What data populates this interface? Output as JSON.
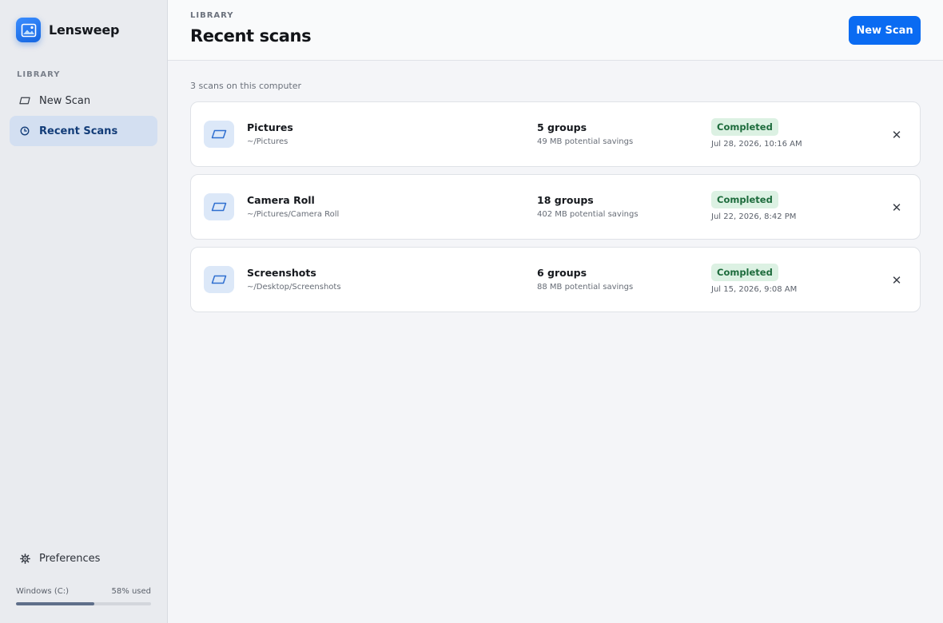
{
  "app": {
    "name": "Lensweep"
  },
  "sidebar": {
    "section_label": "LIBRARY",
    "items": [
      {
        "label": "New Scan",
        "icon": "frame-icon",
        "active": false
      },
      {
        "label": "Recent Scans",
        "icon": "clock-icon",
        "active": true
      }
    ],
    "preferences_label": "Preferences",
    "disk": {
      "label": "Windows (C:)",
      "usage_text": "58% used",
      "usage_fraction": 0.58
    }
  },
  "header": {
    "eyebrow": "LIBRARY",
    "title": "Recent scans",
    "new_scan_label": "New Scan"
  },
  "main": {
    "count_text": "3 scans on this computer",
    "scans": [
      {
        "name": "Pictures",
        "path": "~/Pictures",
        "groups": "5 groups",
        "savings": "49 MB potential savings",
        "status": "Completed",
        "date": "Jul 28, 2026, 10:16 AM"
      },
      {
        "name": "Camera Roll",
        "path": "~/Pictures/Camera Roll",
        "groups": "18 groups",
        "savings": "402 MB potential savings",
        "status": "Completed",
        "date": "Jul 22, 2026, 8:42 PM"
      },
      {
        "name": "Screenshots",
        "path": "~/Desktop/Screenshots",
        "groups": "6 groups",
        "savings": "88 MB potential savings",
        "status": "Completed",
        "date": "Jul 15, 2026, 9:08 AM"
      }
    ]
  },
  "colors": {
    "accent": "#0a6bf2",
    "active_nav_bg": "#d3dff1",
    "status_completed_bg": "#dcf1e3",
    "status_completed_text": "#1d6b3c"
  }
}
